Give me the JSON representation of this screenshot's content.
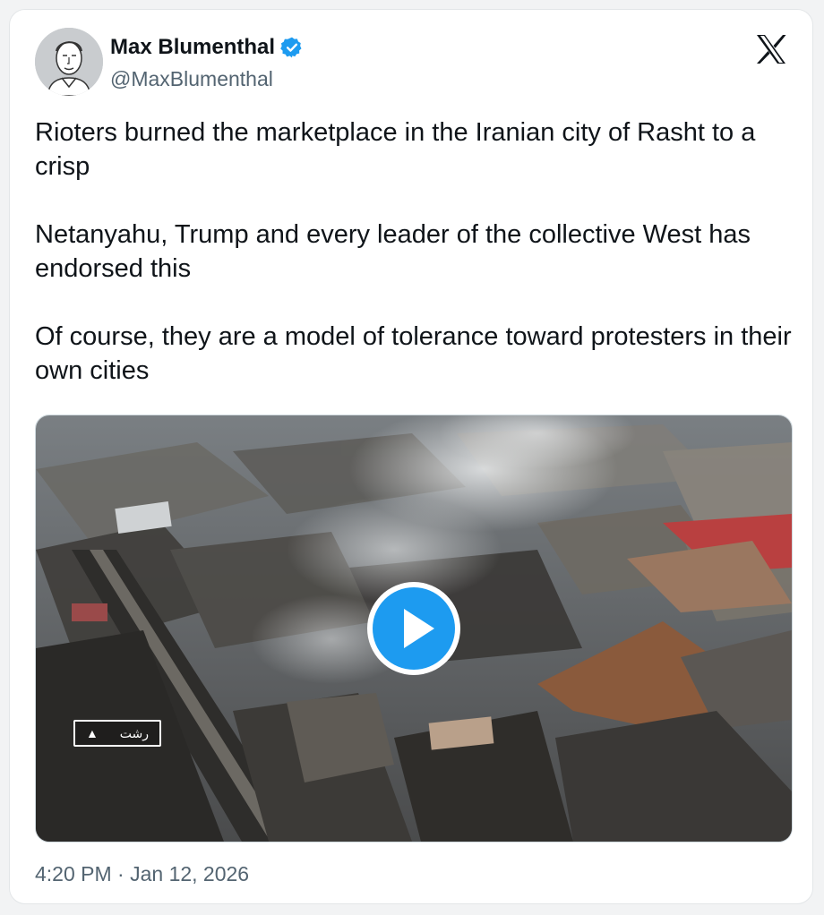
{
  "author": {
    "name": "Max Blumenthal",
    "handle": "@MaxBlumenthal",
    "avatar_icon": "sketch-portrait-avatar",
    "verified_icon": "verified-badge-icon",
    "verified_color": "#1d9bf0"
  },
  "brand": {
    "logo_icon": "x-logo-icon"
  },
  "tweet": {
    "text": "Rioters burned the marketplace in the Iranian city of Rasht to a crisp\n\nNetanyahu, Trump and every leader of the collective West has endorsed this\n\nOf course, they are a model of tolerance toward protesters in their own cities",
    "timestamp": "4:20 PM · Jan 12, 2026"
  },
  "media": {
    "type": "video",
    "play_icon": "play-icon",
    "play_color": "#1d9bf0",
    "overlay_caption": "رشت"
  },
  "colors": {
    "text": "#0f1419",
    "secondary": "#536471",
    "border": "#cfd9de"
  }
}
